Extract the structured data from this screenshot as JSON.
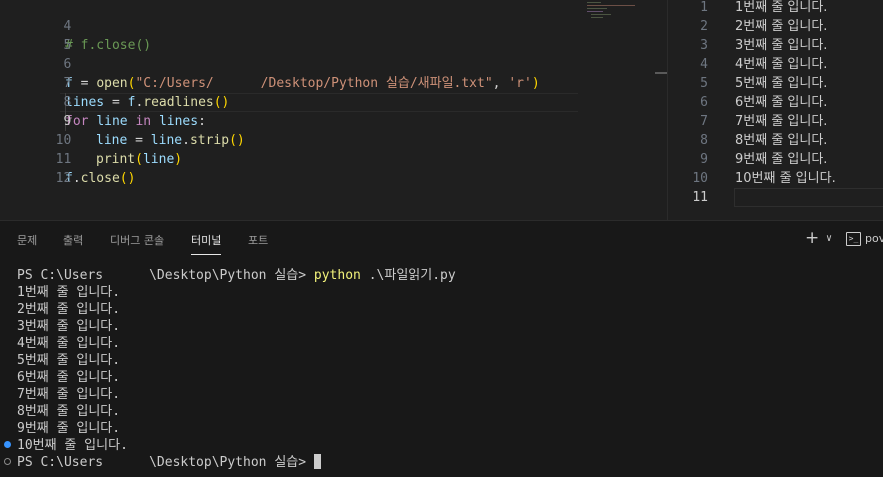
{
  "editor": {
    "lines": [
      {
        "n": "4",
        "code": "# f.close()"
      },
      {
        "n": "5",
        "code": ""
      },
      {
        "n": "6",
        "code": "f = open(\"C:/Users/      /Desktop/Python 실습/새파일.txt\", 'r')"
      },
      {
        "n": "7",
        "code": "lines = f.readlines()"
      },
      {
        "n": "8",
        "code": "for line in lines:"
      },
      {
        "n": "9",
        "code": "    line = line.strip()"
      },
      {
        "n": "10",
        "code": "    print(line)"
      },
      {
        "n": "11",
        "code": "f.close()"
      },
      {
        "n": "12",
        "code": ""
      }
    ],
    "tok": {
      "l4": "# f.close()",
      "l6_f": "f",
      "l6_eq": " = ",
      "l6_open": "open",
      "l6_p": "(",
      "l6_str": "\"C:/Users/      /Desktop/Python 실습/새파일.txt\"",
      "l6_comma": ", ",
      "l6_r": "'r'",
      "l6_pc": ")",
      "l7_lines": "lines",
      "l7_eq": " = ",
      "l7_f": "f",
      "l7_dot": ".",
      "l7_fn": "readlines",
      "l7_p": "()",
      "l8_for": "for",
      "l8_sp": " ",
      "l8_line": "line",
      "l8_in": " in ",
      "l8_lines": "lines",
      "l8_colon": ":",
      "l9_line": "line",
      "l9_eq": " = ",
      "l9_line2": "line",
      "l9_dot": ".",
      "l9_fn": "strip",
      "l9_p": "()",
      "l10_fn": "print",
      "l10_p1": "(",
      "l10_line": "line",
      "l10_p2": ")",
      "l11_f": "f",
      "l11_dot": ".",
      "l11_fn": "close",
      "l11_p": "()"
    }
  },
  "right_editor": {
    "lines": [
      {
        "n": "1",
        "text": "1번째 줄 입니다."
      },
      {
        "n": "2",
        "text": "2번째 줄 입니다."
      },
      {
        "n": "3",
        "text": "3번째 줄 입니다."
      },
      {
        "n": "4",
        "text": "4번째 줄 입니다."
      },
      {
        "n": "5",
        "text": "5번째 줄 입니다."
      },
      {
        "n": "6",
        "text": "6번째 줄 입니다."
      },
      {
        "n": "7",
        "text": "7번째 줄 입니다."
      },
      {
        "n": "8",
        "text": "8번째 줄 입니다."
      },
      {
        "n": "9",
        "text": "9번째 줄 입니다."
      },
      {
        "n": "10",
        "text": "10번째 줄 입니다."
      },
      {
        "n": "11",
        "text": ""
      }
    ]
  },
  "panel": {
    "tabs": [
      "문제",
      "출력",
      "디버그 콘솔",
      "터미널",
      "포트"
    ],
    "active_tab": "터미널",
    "plus": "+",
    "chevron": "∨",
    "shell_icon": ">_",
    "shell_label": "pov"
  },
  "terminal": {
    "prompt_prefix": "PS C:\\Users",
    "prompt_suffix": "\\Desktop\\Python 실습>",
    "command": "python",
    "command_arg": " .\\파일읽기.py",
    "output": [
      "1번째 줄 입니다.",
      "2번째 줄 입니다.",
      "3번째 줄 입니다.",
      "4번째 줄 입니다.",
      "5번째 줄 입니다.",
      "6번째 줄 입니다.",
      "7번째 줄 입니다.",
      "8번째 줄 입니다.",
      "9번째 줄 입니다.",
      "10번째 줄 입니다."
    ]
  },
  "colors": {
    "background": "#1f1f1f",
    "panel": "#181818",
    "comment": "#6a9955",
    "keyword": "#c586c0",
    "function": "#dcdcaa",
    "string": "#ce9178",
    "variable": "#9cdcfe",
    "terminal_command": "#f2f27a",
    "decoration_blue": "#3794ff"
  }
}
